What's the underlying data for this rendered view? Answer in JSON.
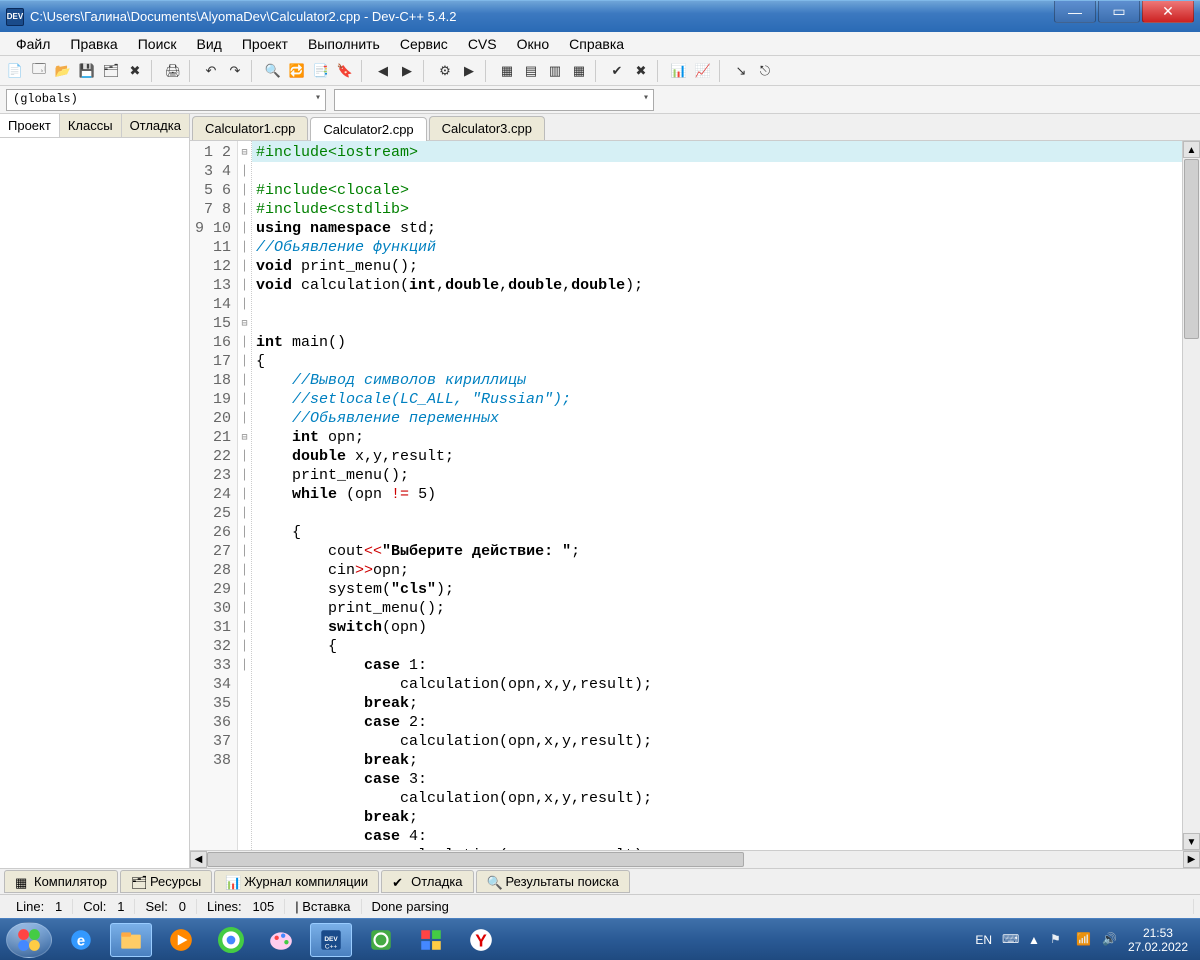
{
  "titlebar": {
    "icon_text": "DEV",
    "title": "C:\\Users\\Галина\\Documents\\AlyomaDev\\Calculator2.cpp - Dev-C++ 5.4.2"
  },
  "menu": [
    "Файл",
    "Правка",
    "Поиск",
    "Вид",
    "Проект",
    "Выполнить",
    "Сервис",
    "CVS",
    "Окно",
    "Справка"
  ],
  "dropdowns": {
    "globals": "(globals)",
    "second": ""
  },
  "side_tabs": [
    "Проект",
    "Классы",
    "Отладка"
  ],
  "file_tabs": [
    "Calculator1.cpp",
    "Calculator2.cpp",
    "Calculator3.cpp"
  ],
  "active_file_tab": 1,
  "code_lines": [
    {
      "n": 1,
      "fold": "",
      "hl": true,
      "html": "<span class='pp'>#include&lt;iostream&gt;</span>"
    },
    {
      "n": 2,
      "fold": "",
      "html": "<span class='pp'>#include&lt;clocale&gt;</span>"
    },
    {
      "n": 3,
      "fold": "",
      "html": "<span class='pp'>#include&lt;cstdlib&gt;</span>"
    },
    {
      "n": 4,
      "fold": "",
      "html": "<span class='kw'>using</span> <span class='kw'>namespace</span> std;"
    },
    {
      "n": 5,
      "fold": "",
      "html": "<span class='cm'>//Обьявление функций</span>"
    },
    {
      "n": 6,
      "fold": "",
      "html": "<span class='kw'>void</span> print_menu();"
    },
    {
      "n": 7,
      "fold": "",
      "html": "<span class='kw'>void</span> calculation(<span class='kw'>int</span>,<span class='kw'>double</span>,<span class='kw'>double</span>,<span class='kw'>double</span>);"
    },
    {
      "n": 8,
      "fold": "",
      "html": ""
    },
    {
      "n": 9,
      "fold": "",
      "html": ""
    },
    {
      "n": 10,
      "fold": "",
      "html": "<span class='kw'>int</span> main()"
    },
    {
      "n": 11,
      "fold": "⊟",
      "html": "{"
    },
    {
      "n": 12,
      "fold": "│",
      "html": "    <span class='cm'>//Вывод символов кириллицы</span>"
    },
    {
      "n": 13,
      "fold": "│",
      "html": "    <span class='cm'>//setlocale(LC_ALL, \"Russian\");</span>"
    },
    {
      "n": 14,
      "fold": "│",
      "html": "    <span class='cm'>//Обьявление переменных</span>"
    },
    {
      "n": 15,
      "fold": "│",
      "html": "    <span class='kw'>int</span> opn;"
    },
    {
      "n": 16,
      "fold": "│",
      "html": "    <span class='kw'>double</span> x,y,result;"
    },
    {
      "n": 17,
      "fold": "│",
      "html": "    print_menu();"
    },
    {
      "n": 18,
      "fold": "│",
      "html": "    <span class='kw'>while</span> (opn <span class='op'>!=</span> 5)"
    },
    {
      "n": 19,
      "fold": "│",
      "html": ""
    },
    {
      "n": 20,
      "fold": "⊟",
      "html": "    {"
    },
    {
      "n": 21,
      "fold": "│",
      "html": "        cout<span class='op'>&lt;&lt;</span><span class='st'>\"Выберите действие: \"</span>;"
    },
    {
      "n": 22,
      "fold": "│",
      "html": "        cin<span class='op'>&gt;&gt;</span>opn;"
    },
    {
      "n": 23,
      "fold": "│",
      "html": "        system(<span class='st'>\"cls\"</span>);"
    },
    {
      "n": 24,
      "fold": "│",
      "html": "        print_menu();"
    },
    {
      "n": 25,
      "fold": "│",
      "html": "        <span class='kw'>switch</span>(opn)"
    },
    {
      "n": 26,
      "fold": "⊟",
      "html": "        {"
    },
    {
      "n": 27,
      "fold": "│",
      "html": "            <span class='kw'>case</span> 1:"
    },
    {
      "n": 28,
      "fold": "│",
      "html": "                calculation(opn,x,y,result);"
    },
    {
      "n": 29,
      "fold": "│",
      "html": "            <span class='kw'>break</span>;"
    },
    {
      "n": 30,
      "fold": "│",
      "html": "            <span class='kw'>case</span> 2:"
    },
    {
      "n": 31,
      "fold": "│",
      "html": "                calculation(opn,x,y,result);"
    },
    {
      "n": 32,
      "fold": "│",
      "html": "            <span class='kw'>break</span>;"
    },
    {
      "n": 33,
      "fold": "│",
      "html": "            <span class='kw'>case</span> 3:"
    },
    {
      "n": 34,
      "fold": "│",
      "html": "                calculation(opn,x,y,result);"
    },
    {
      "n": 35,
      "fold": "│",
      "html": "            <span class='kw'>break</span>;"
    },
    {
      "n": 36,
      "fold": "│",
      "html": "            <span class='kw'>case</span> 4:"
    },
    {
      "n": 37,
      "fold": "│",
      "html": "                calculation(opn,x,y,result);"
    },
    {
      "n": 38,
      "fold": "│",
      "html": "            <span class='kw'>break</span>;"
    }
  ],
  "bottom_tabs": [
    "Компилятор",
    "Ресурсы",
    "Журнал компиляции",
    "Отладка",
    "Результаты поиска"
  ],
  "status": {
    "line_label": "Line:",
    "line": "1",
    "col_label": "Col:",
    "col": "1",
    "sel_label": "Sel:",
    "sel": "0",
    "lines_label": "Lines:",
    "lines": "105",
    "ins": "Вставка",
    "parse": "Done parsing"
  },
  "tray": {
    "lang": "EN",
    "time": "21:53",
    "date": "27.02.2022"
  },
  "colors": {
    "title_grad_top": "#6fa5d8",
    "title_grad_bot": "#2a6ab5",
    "close_red": "#c22"
  }
}
